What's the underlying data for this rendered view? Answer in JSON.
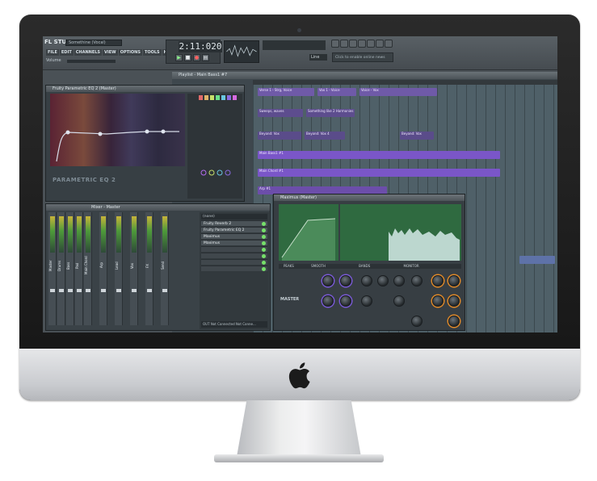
{
  "fl_studio": {
    "logo": "FL STUDIO",
    "song_title": "Somethine (Vocal)",
    "menus": [
      "FILE",
      "EDIT",
      "CHANNELS",
      "VIEW",
      "OPTIONS",
      "TOOLS",
      "HELP"
    ],
    "volume_label": "Volume",
    "time_display": "2:11:020",
    "line_label": "Line",
    "hint_text": "Click to enable online news"
  },
  "playlist": {
    "title": "Playlist - Main Bass1 #7",
    "tracks": [
      "Verse 1 - Strg, Voice",
      "Vox 1 - Voice",
      "Voice - Vox",
      "Sweeps, waves",
      "Something like 2 Harmonies",
      "Beyond: Vox",
      "Beyond: Vox 4",
      "Beyond: Vox",
      "Main Bass1 #1",
      "Main Chord #1",
      "Arp #1"
    ]
  },
  "eq": {
    "title": "Fruity Parametric EQ 2 (Master)",
    "label": "PARAMETRIC EQ 2"
  },
  "mixer": {
    "title": "Mixer - Master",
    "strips": [
      "Master",
      "Drums",
      "Bass",
      "Pad",
      "Main Chord",
      "Arp",
      "Lead",
      "Vox",
      "FX",
      "Send"
    ],
    "fx_head": "(none)",
    "fx_slots": [
      "Fruity Reverb 2",
      "Fruity Parametric EQ 2",
      "Maximus",
      "Maximus",
      "",
      "",
      "",
      ""
    ],
    "out_label": "OUT",
    "out_left": "Not Connected",
    "out_right": "Not Conne..."
  },
  "maximus": {
    "title": "Maximus (Master)",
    "master_label": "MASTER",
    "tabs": [
      "PEAKS",
      "SMOOTH",
      "BANDS",
      "MONITOR"
    ]
  },
  "colors": {
    "eq_accent": "#b46cf0",
    "maximus_green": "#2f6a40",
    "clip_purple": "#7a56c8"
  }
}
